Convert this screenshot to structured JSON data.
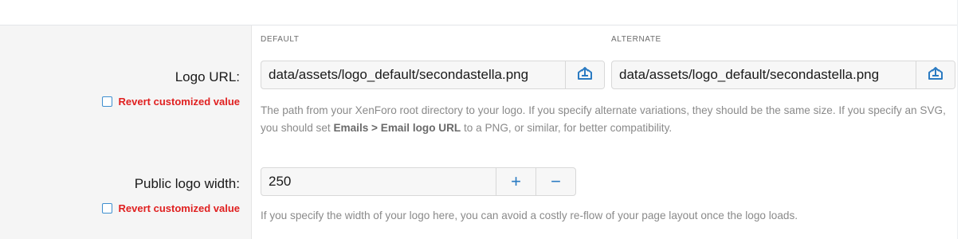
{
  "columns": {
    "default_header": "DEFAULT",
    "alternate_header": "ALTERNATE"
  },
  "logo_url": {
    "label": "Logo URL:",
    "revert_label": "Revert customized value",
    "default_value": "data/assets/logo_default/secondastella.png",
    "alternate_value": "data/assets/logo_default/secondastella.png",
    "upload_icon": "upload-icon",
    "hint_before": "The path from your XenForo root directory to your logo. If you specify alternate variations, they should be the same size. If you specify an SVG, you should set ",
    "hint_bold": "Emails > Email logo URL",
    "hint_after": " to a PNG, or similar, for better compatibility."
  },
  "public_logo_width": {
    "label": "Public logo width:",
    "revert_label": "Revert customized value",
    "value": "250",
    "increment": "+",
    "decrement": "−",
    "hint": "If you specify the width of your logo here, you can avoid a costly re-flow of your page layout once the logo loads."
  },
  "colors": {
    "accent": "#2b7bc2",
    "revert": "#e02020",
    "label_bg": "#f5f5f5",
    "hint_text": "#8a8a8a"
  }
}
